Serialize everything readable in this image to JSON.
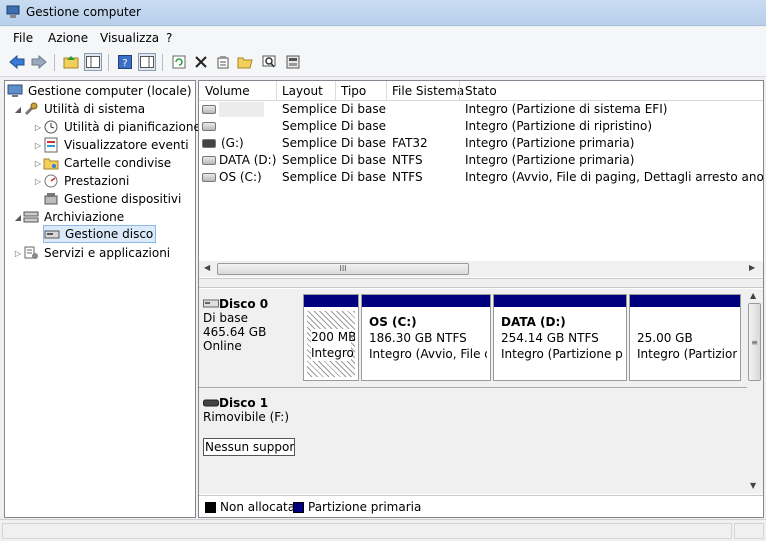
{
  "window": {
    "title": "Gestione computer"
  },
  "menu": [
    "File",
    "Azione",
    "Visualizza",
    "?"
  ],
  "toolbar": {
    "icons": [
      "back-arrow-icon",
      "forward-arrow-icon",
      "up-folder-icon",
      "show-hide-tree-icon",
      "help-icon",
      "action-pane-icon",
      "refresh-icon",
      "delete-icon",
      "properties-icon",
      "open-folder-icon",
      "search-icon",
      "rescan-disks-icon"
    ]
  },
  "tree": {
    "root": "Gestione computer (locale)",
    "utility": "Utilità di sistema",
    "utility_children": [
      "Utilità di pianificazione",
      "Visualizzatore eventi",
      "Cartelle condivise",
      "Prestazioni",
      "Gestione dispositivi"
    ],
    "storage": "Archiviazione",
    "storage_children": [
      "Gestione disco"
    ],
    "services": "Servizi e applicazioni"
  },
  "volume_list": {
    "headers": [
      "Volume",
      "Layout",
      "Tipo",
      "File Sistema",
      "Stato"
    ],
    "rows": [
      {
        "volume": "",
        "layout": "Semplice",
        "tipo": "Di base",
        "fs": "",
        "stato": "Integro (Partizione di sistema EFI)"
      },
      {
        "volume": "",
        "layout": "Semplice",
        "tipo": "Di base",
        "fs": "",
        "stato": "Integro (Partizione di ripristino)"
      },
      {
        "volume": "(G:)",
        "layout": "Semplice",
        "tipo": "Di base",
        "fs": "FAT32",
        "stato": "Integro (Partizione primaria)"
      },
      {
        "volume": "DATA (D:)",
        "layout": "Semplice",
        "tipo": "Di base",
        "fs": "NTFS",
        "stato": "Integro (Partizione primaria)"
      },
      {
        "volume": "OS (C:)",
        "layout": "Semplice",
        "tipo": "Di base",
        "fs": "NTFS",
        "stato": "Integro (Avvio, File di paging, Dettagli arresto anomalo d"
      }
    ],
    "scroll_thumb": "III"
  },
  "disks": {
    "disk0": {
      "name": "Disco 0",
      "type": "Di base",
      "size": "465.64 GB",
      "status": "Online",
      "partitions": [
        {
          "title": "",
          "size": "200 MB",
          "status": "Integro"
        },
        {
          "title": "OS  (C:)",
          "size": "186.30 GB NTFS",
          "status": "Integro (Avvio, File di"
        },
        {
          "title": "DATA  (D:)",
          "size": "254.14 GB NTFS",
          "status": "Integro (Partizione prin"
        },
        {
          "title": "",
          "size": "25.00 GB",
          "status": "Integro (Partizione"
        }
      ]
    },
    "disk1": {
      "name": "Disco 1",
      "type": "Rimovibile (F:)",
      "media": "Nessun supporto"
    },
    "vscroll_thumb": "≡"
  },
  "legend": [
    {
      "label": "Non allocata",
      "color": "#000000"
    },
    {
      "label": "Partizione primaria",
      "color": "#00007f"
    }
  ]
}
